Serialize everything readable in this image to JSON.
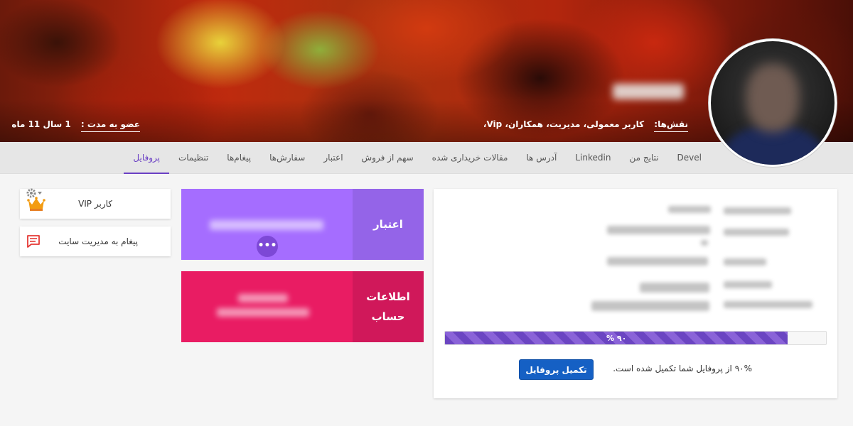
{
  "header": {
    "roles_label": "نقش‌ها:",
    "roles": "کاربر معمولی، مدیریت، همکاران، Vip،",
    "member_label": "عضو به مدت :",
    "member_value": "1 سال 11 ماه"
  },
  "tabs": [
    "پروفایل",
    "تنظیمات",
    "پیغام‌ها",
    "سفارش‌ها",
    "اعتبار",
    "سهم از فروش",
    "مقالات خریداری شده",
    "آدرس ها",
    "Linkedin",
    "نتایج من",
    "Devel"
  ],
  "active_tab": "پروفایل",
  "sidebar": {
    "vip_label": "کاربر VIP",
    "message_label": "پیغام به مدیریت سایت"
  },
  "cards": {
    "credit_title": "اعتبار",
    "credit_more": "•••",
    "account_title_line1": "اطلاعات",
    "account_title_line2": "حساب"
  },
  "profile": {
    "progress_percent": 90,
    "progress_label": "۹۰ %",
    "complete_text": "۹۰% از پروفایل شما تکمیل شده است.",
    "complete_button": "تکمیل پروفایل"
  },
  "colors": {
    "accent": "#6a3fc4",
    "credit": "#a56dff",
    "account": "#e91c63",
    "button": "#1560c4"
  },
  "icons": [
    "settings-gear-icon",
    "crown-icon",
    "message-icon",
    "more-dots-icon"
  ]
}
